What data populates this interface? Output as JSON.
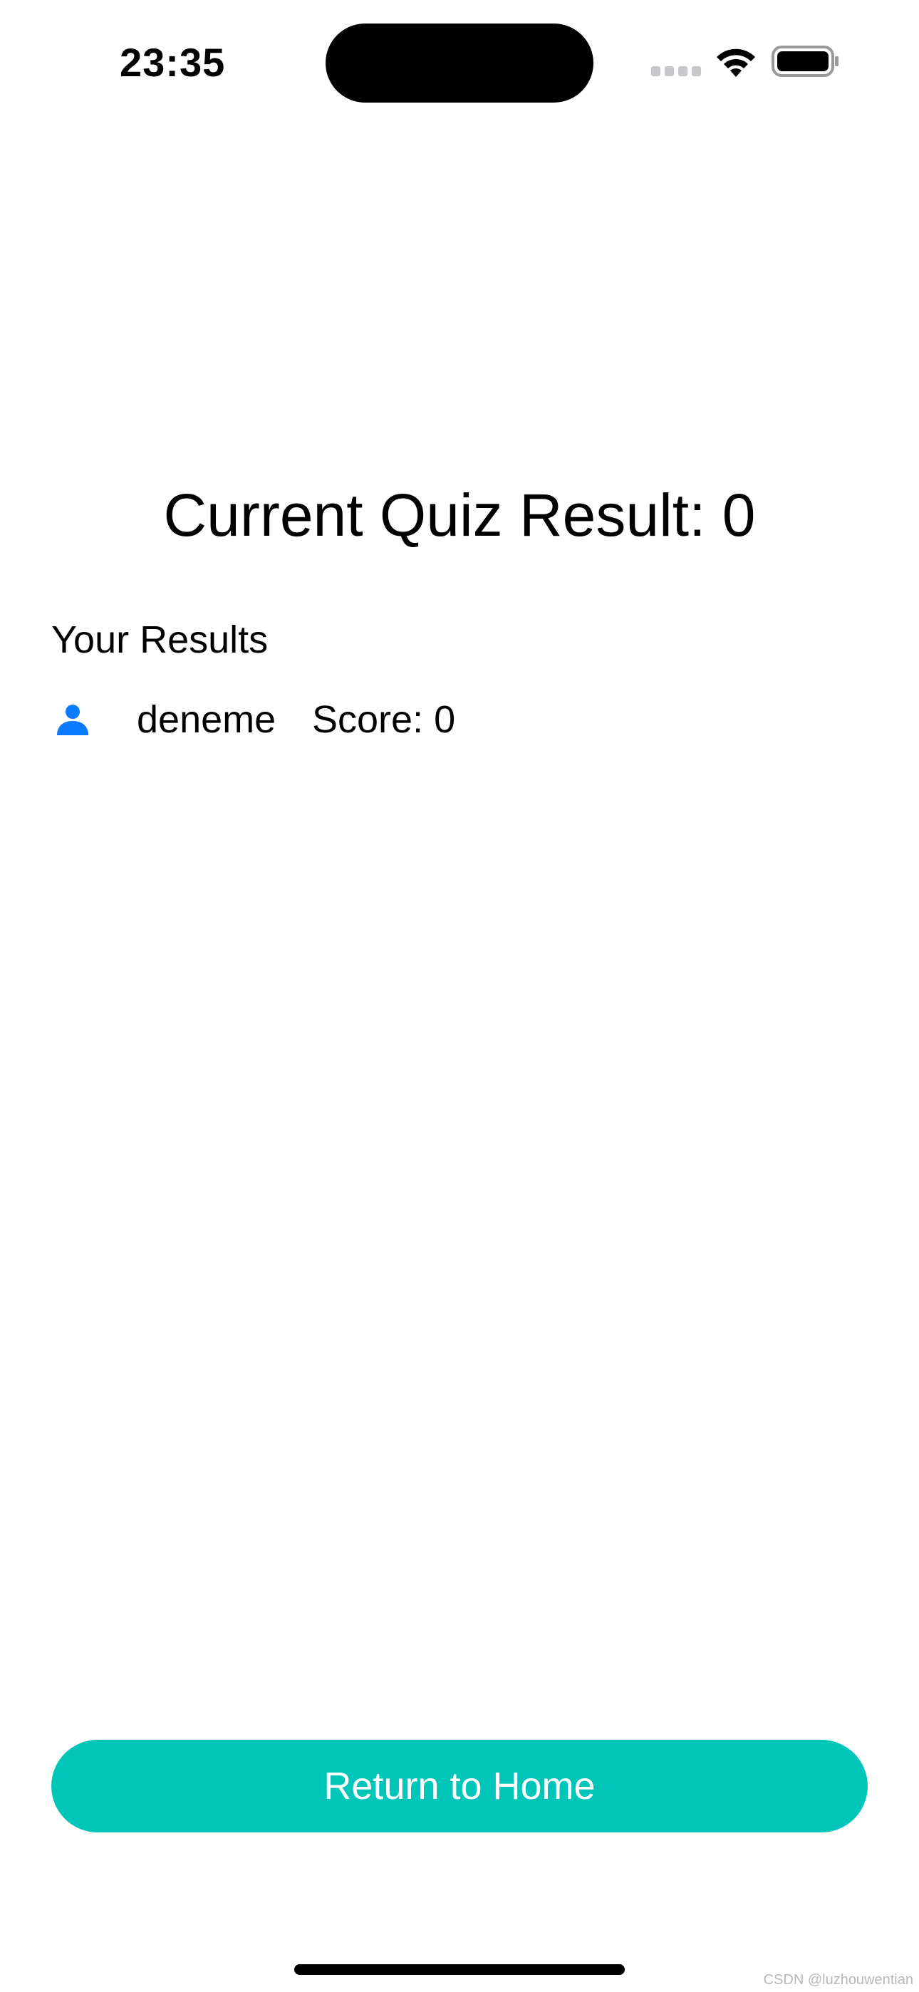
{
  "status_bar": {
    "time": "23:35",
    "icons": [
      "cellular-signal-icon",
      "wifi-icon",
      "battery-icon"
    ]
  },
  "main": {
    "quiz_result_text": "Current Quiz Result: 0",
    "results_heading": "Your Results",
    "results": [
      {
        "icon": "person-icon",
        "name": "deneme",
        "score_text": "Score: 0"
      }
    ]
  },
  "footer": {
    "return_button_label": "Return to Home"
  },
  "watermark": "CSDN @luzhouwentian",
  "colors": {
    "accent_button": "#00C6B9",
    "person_icon": "#0A7AFF",
    "text": "#000000"
  }
}
